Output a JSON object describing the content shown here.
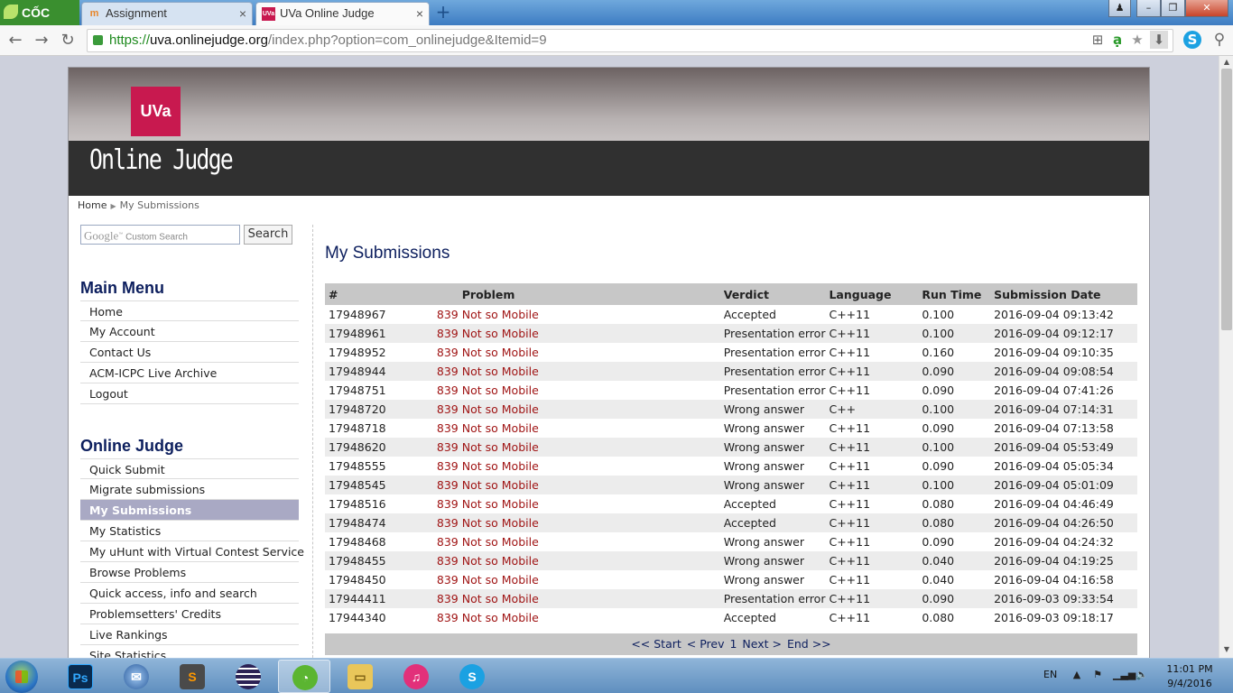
{
  "browser": {
    "brand": "CỐC CỐC",
    "tabs": [
      {
        "title": "Assignment",
        "favicon": "m"
      },
      {
        "title": "UVa Online Judge",
        "favicon": "UVa"
      }
    ],
    "url": {
      "scheme": "https://",
      "host": "uva.onlinejudge.org",
      "path": "/index.php?option=com_onlinejudge&Itemid=9"
    }
  },
  "site": {
    "logo": "UVa",
    "title": "Online Judge"
  },
  "breadcrumb": {
    "home": "Home",
    "current": "My Submissions"
  },
  "search": {
    "brand": "Google",
    "placeholder": "Custom Search",
    "button": "Search"
  },
  "main_menu": {
    "title": "Main Menu",
    "items": [
      "Home",
      "My Account",
      "Contact Us",
      "ACM-ICPC Live Archive",
      "Logout"
    ]
  },
  "judge_menu": {
    "title": "Online Judge",
    "items": [
      "Quick Submit",
      "Migrate submissions",
      "My Submissions",
      "My Statistics",
      "My uHunt with Virtual Contest Service",
      "Browse Problems",
      "Quick access, info and search",
      "Problemsetters' Credits",
      "Live Rankings",
      "Site Statistics"
    ],
    "selected": "My Submissions"
  },
  "submissions": {
    "title": "My Submissions",
    "columns": [
      "#",
      "Problem",
      "Verdict",
      "Language",
      "Run Time",
      "Submission Date"
    ],
    "rows": [
      {
        "id": "17948967",
        "pid": "839",
        "problem": "Not so Mobile",
        "verdict": "Accepted",
        "language": "C++11",
        "runtime": "0.100",
        "date": "2016-09-04 09:13:42"
      },
      {
        "id": "17948961",
        "pid": "839",
        "problem": "Not so Mobile",
        "verdict": "Presentation error",
        "language": "C++11",
        "runtime": "0.100",
        "date": "2016-09-04 09:12:17"
      },
      {
        "id": "17948952",
        "pid": "839",
        "problem": "Not so Mobile",
        "verdict": "Presentation error",
        "language": "C++11",
        "runtime": "0.160",
        "date": "2016-09-04 09:10:35"
      },
      {
        "id": "17948944",
        "pid": "839",
        "problem": "Not so Mobile",
        "verdict": "Presentation error",
        "language": "C++11",
        "runtime": "0.090",
        "date": "2016-09-04 09:08:54"
      },
      {
        "id": "17948751",
        "pid": "839",
        "problem": "Not so Mobile",
        "verdict": "Presentation error",
        "language": "C++11",
        "runtime": "0.090",
        "date": "2016-09-04 07:41:26"
      },
      {
        "id": "17948720",
        "pid": "839",
        "problem": "Not so Mobile",
        "verdict": "Wrong answer",
        "language": "C++",
        "runtime": "0.100",
        "date": "2016-09-04 07:14:31"
      },
      {
        "id": "17948718",
        "pid": "839",
        "problem": "Not so Mobile",
        "verdict": "Wrong answer",
        "language": "C++11",
        "runtime": "0.090",
        "date": "2016-09-04 07:13:58"
      },
      {
        "id": "17948620",
        "pid": "839",
        "problem": "Not so Mobile",
        "verdict": "Wrong answer",
        "language": "C++11",
        "runtime": "0.100",
        "date": "2016-09-04 05:53:49"
      },
      {
        "id": "17948555",
        "pid": "839",
        "problem": "Not so Mobile",
        "verdict": "Wrong answer",
        "language": "C++11",
        "runtime": "0.090",
        "date": "2016-09-04 05:05:34"
      },
      {
        "id": "17948545",
        "pid": "839",
        "problem": "Not so Mobile",
        "verdict": "Wrong answer",
        "language": "C++11",
        "runtime": "0.100",
        "date": "2016-09-04 05:01:09"
      },
      {
        "id": "17948516",
        "pid": "839",
        "problem": "Not so Mobile",
        "verdict": "Accepted",
        "language": "C++11",
        "runtime": "0.080",
        "date": "2016-09-04 04:46:49"
      },
      {
        "id": "17948474",
        "pid": "839",
        "problem": "Not so Mobile",
        "verdict": "Accepted",
        "language": "C++11",
        "runtime": "0.080",
        "date": "2016-09-04 04:26:50"
      },
      {
        "id": "17948468",
        "pid": "839",
        "problem": "Not so Mobile",
        "verdict": "Wrong answer",
        "language": "C++11",
        "runtime": "0.090",
        "date": "2016-09-04 04:24:32"
      },
      {
        "id": "17948455",
        "pid": "839",
        "problem": "Not so Mobile",
        "verdict": "Wrong answer",
        "language": "C++11",
        "runtime": "0.040",
        "date": "2016-09-04 04:19:25"
      },
      {
        "id": "17948450",
        "pid": "839",
        "problem": "Not so Mobile",
        "verdict": "Wrong answer",
        "language": "C++11",
        "runtime": "0.040",
        "date": "2016-09-04 04:16:58"
      },
      {
        "id": "17944411",
        "pid": "839",
        "problem": "Not so Mobile",
        "verdict": "Presentation error",
        "language": "C++11",
        "runtime": "0.090",
        "date": "2016-09-03 09:33:54"
      },
      {
        "id": "17944340",
        "pid": "839",
        "problem": "Not so Mobile",
        "verdict": "Accepted",
        "language": "C++11",
        "runtime": "0.080",
        "date": "2016-09-03 09:18:17"
      }
    ]
  },
  "pagination": {
    "start": "<< Start",
    "prev": "< Prev",
    "current": "1",
    "next": "Next >",
    "end": "End >>"
  },
  "taskbar": {
    "apps": [
      "windows-start",
      "photoshop",
      "thunderbird",
      "sublime-text",
      "eclipse",
      "coccoc-browser",
      "file-explorer",
      "music-player",
      "skype"
    ],
    "language": "EN",
    "time": "11:01 PM",
    "date": "9/4/2016"
  },
  "colors": {
    "accent": "#c8194f",
    "heading": "#0d1f5e",
    "problem_link": "#a01515",
    "header_band": "#303030"
  }
}
